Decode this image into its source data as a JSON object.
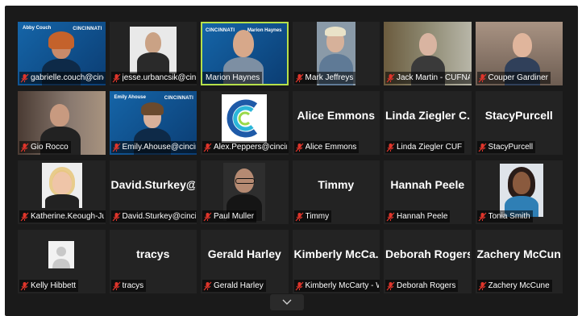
{
  "colors": {
    "background": "#1a1a1a",
    "tile": "#232323",
    "active_border": "#b6e04a",
    "muted_icon": "#e0352b"
  },
  "tiles": [
    {
      "label": "gabrielle.couch@cinci...",
      "banner_name": "Abby Couch",
      "brand": "CINCINNATI"
    },
    {
      "label": "jesse.urbancsik@cinci..."
    },
    {
      "label": "Marion Haynes",
      "banner_name": "Marion Haynes",
      "brand": "CINCINNATI"
    },
    {
      "label": "Mark Jeffreys"
    },
    {
      "label": "Jack Martin - CUFNA"
    },
    {
      "label": "Couper Gardiner"
    },
    {
      "label": "Gio Rocco"
    },
    {
      "label": "Emily.Ahouse@cincinn...",
      "banner_name": "Emily Ahouse",
      "brand": "CINCINNATI"
    },
    {
      "label": "Alex.Peppers@cincinn..."
    },
    {
      "label": "Alice Emmons",
      "display_name": "Alice Emmons"
    },
    {
      "label": "Linda Ziegler  CUF",
      "display_name": "Linda Ziegler  C..."
    },
    {
      "label": "StacyPurcell",
      "display_name": "StacyPurcell"
    },
    {
      "label": "Katherine.Keough-Jurs..."
    },
    {
      "label": "David.Sturkey@cincin...",
      "display_name": "David.Sturkey@..."
    },
    {
      "label": "Paul Muller"
    },
    {
      "label": "Timmy",
      "display_name": "Timmy"
    },
    {
      "label": "Hannah Peele",
      "display_name": "Hannah Peele"
    },
    {
      "label": "Tonia Smith"
    },
    {
      "label": "Kelly Hibbett"
    },
    {
      "label": "tracys",
      "display_name": "tracys"
    },
    {
      "label": "Gerald Harley",
      "display_name": "Gerald Harley"
    },
    {
      "label": "Kimberly McCarty - W...",
      "display_name": "Kimberly McCa..."
    },
    {
      "label": "Deborah Rogers",
      "display_name": "Deborah Rogers"
    },
    {
      "label": "Zachery McCune",
      "display_name": "Zachery McCune"
    }
  ],
  "icons": {
    "muted": "muted-mic-icon",
    "expand": "chevron-down-icon"
  }
}
